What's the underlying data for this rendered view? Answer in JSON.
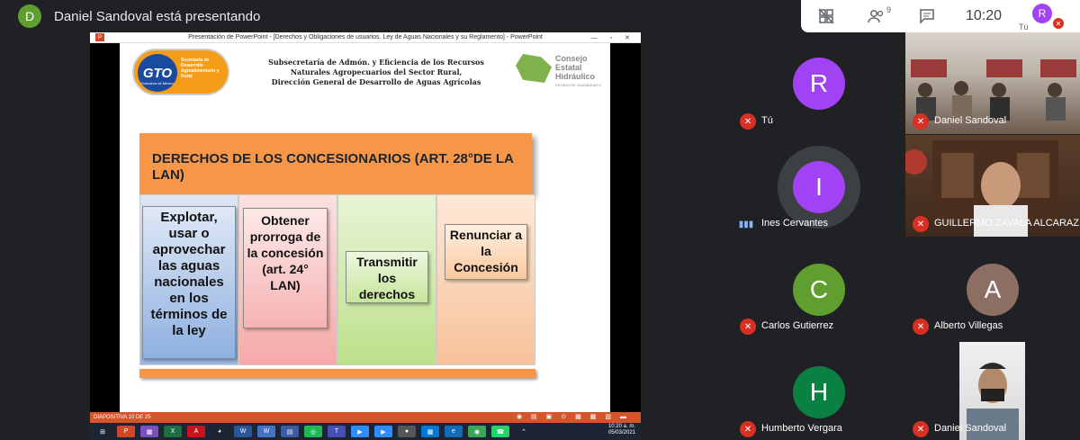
{
  "presenter": {
    "initial": "D",
    "label": "Daniel Sandoval está presentando"
  },
  "toolbar": {
    "participants_badge": "9",
    "time": "10:20",
    "self_initial": "R",
    "self_label": "Tú"
  },
  "ppt": {
    "window_title": "Presentación de PowerPoint - [Derechos y Obligaciones de usuarios. Ley de Aguas Nacionales y su Reglamento] - PowerPoint",
    "status_slide": "DIAPOSITIVA 10 DE 25",
    "slide": {
      "gto_logo": "GTO",
      "gto_sub": "Grandeza de México",
      "gto_text": "Secretaría de Desarrollo Agroalimentario y Rural",
      "header_lines": [
        "Subsecretaría de Admón. y Eficiencia de los Recursos",
        "Naturales Agropecuarios del Sector Rural,",
        "Dirección General de Desarrollo de Aguas Agrícolas"
      ],
      "ch_logo_lines": [
        "Consejo",
        "Estatal",
        "Hidráulico"
      ],
      "ch_logo_sub": "ESTADO DE GUANAJUATO",
      "heading": "DERECHOS DE LOS CONCESIONARIOS  (ART. 28°DE LA LAN)",
      "columns": [
        "Explotar, usar o aprovechar las aguas nacionales en los términos de la ley",
        "Obtener prorroga de la concesión (art.  24° LAN)",
        "Transmitir los derechos",
        "Renunciar a la Concesión"
      ]
    }
  },
  "taskbar": {
    "time": "10:20 a. m.",
    "date": "05/03/2021"
  },
  "participants": [
    {
      "name": "Tú",
      "initial": "R",
      "color": "#a142f4",
      "muted": true
    },
    {
      "name": "Daniel Sandoval",
      "muted": true
    },
    {
      "name": "Ines Cervantes",
      "initial": "I",
      "color": "#a142f4",
      "muted": false
    },
    {
      "name": "GUILLERMO ZAVALA ALCARAZ",
      "muted": true
    },
    {
      "name": "Carlos Gutierrez",
      "initial": "C",
      "color": "#5f9e2f",
      "muted": true
    },
    {
      "name": "Alberto Villegas",
      "initial": "A",
      "color": "#8d6e63",
      "muted": true
    },
    {
      "name": "Humberto Vergara",
      "initial": "H",
      "color": "#0b8043",
      "muted": true
    },
    {
      "name": "Daniel Sandoval",
      "muted": true
    }
  ]
}
